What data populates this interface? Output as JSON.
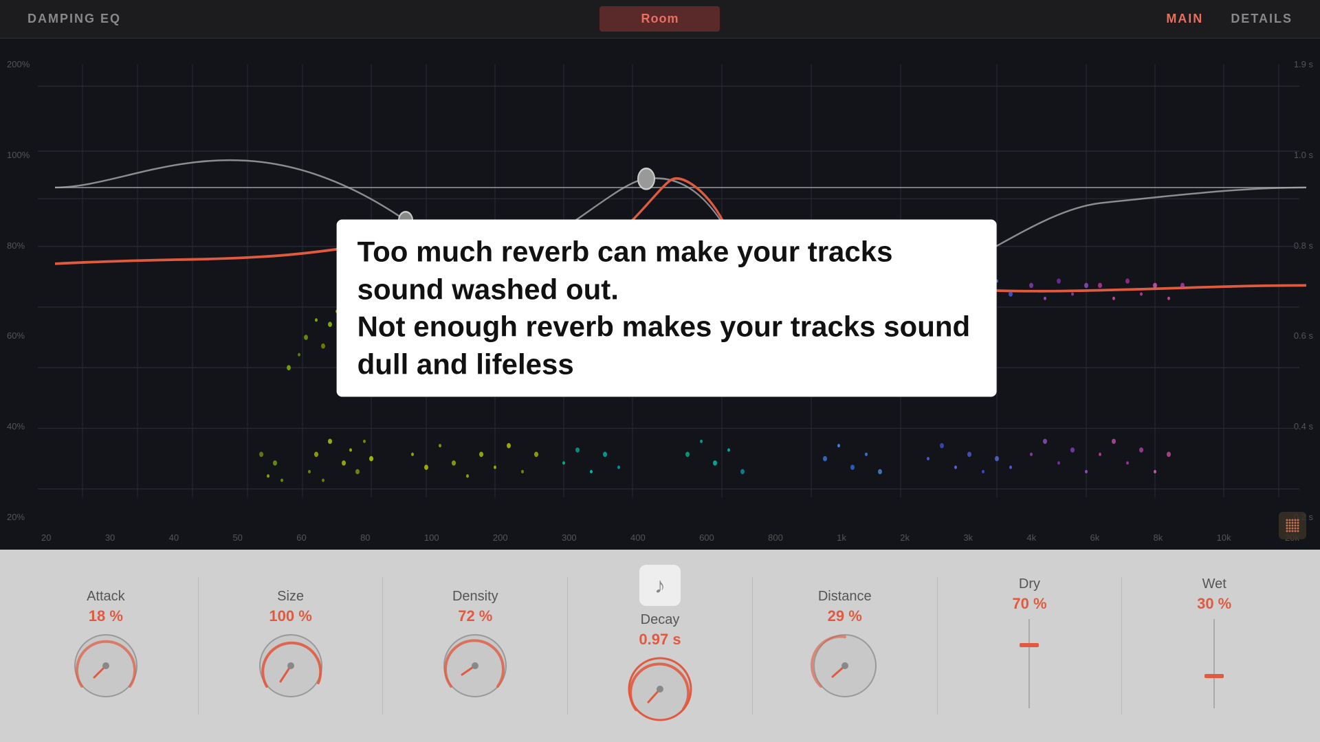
{
  "header": {
    "damping_eq_label": "DAMPING EQ",
    "room_label": "Room",
    "main_label": "MAIN",
    "details_label": "DETAILS"
  },
  "eq_display": {
    "y_labels": [
      "200%",
      "100%",
      "80%",
      "60%",
      "40%",
      "20%"
    ],
    "y_labels_right": [
      "1.9 s",
      "1.0 s",
      "0.8 s",
      "0.6 s",
      "0.4 s",
      "0.2 s"
    ],
    "x_labels": [
      "20",
      "30",
      "40",
      "50",
      "60",
      "80",
      "100",
      "200",
      "300",
      "400",
      "600",
      "800",
      "1k",
      "2k",
      "3k",
      "4k",
      "6k",
      "8k",
      "10k",
      "20k"
    ]
  },
  "tooltip": {
    "line1": "Too much reverb can make your tracks sound washed out.",
    "line2": "Not enough reverb makes your tracks sound dull and lifeless"
  },
  "controls": {
    "attack": {
      "label": "Attack",
      "value": "18 %"
    },
    "size": {
      "label": "Size",
      "value": "100 %"
    },
    "density": {
      "label": "Density",
      "value": "72 %"
    },
    "decay": {
      "label": "Decay",
      "value": "0.97 s"
    },
    "distance": {
      "label": "Distance",
      "value": "29 %"
    },
    "dry": {
      "label": "Dry",
      "value": "70 %"
    },
    "wet": {
      "label": "Wet",
      "value": "30 %"
    }
  },
  "icons": {
    "music_note": "♪",
    "particle": "⣿"
  },
  "colors": {
    "accent": "#e05a40",
    "active_nav": "#e87060",
    "background_dark": "#12141a",
    "knob_track": "#444",
    "knob_value": "#e05a40"
  }
}
